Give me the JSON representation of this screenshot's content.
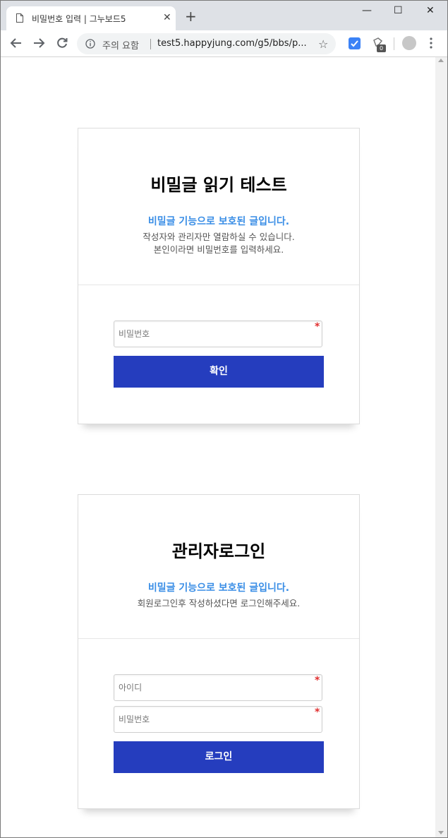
{
  "browser": {
    "tab_title": "비밀번호 입력 | 그누보드5",
    "tab_close": "✕",
    "new_tab": "+",
    "window_controls": {
      "minimize": "—",
      "maximize": "☐",
      "close": "✕"
    },
    "security_warning": "주의 요함",
    "url": "test5.happyjung.com/g5/bbs/p...",
    "star_glyph": "☆",
    "extension_badge": "0"
  },
  "secret_card": {
    "title": "비밀글 읽기 테스트",
    "subtitle": "비밀글 기능으로 보호된 글입니다.",
    "desc_line1": "작성자와 관리자만 열람하실 수 있습니다.",
    "desc_line2": "본인이라면 비밀번호를 입력하세요.",
    "password_placeholder": "비밀번호",
    "required_mark": "*",
    "confirm_label": "확인"
  },
  "login_card": {
    "title": "관리자로그인",
    "subtitle": "비밀글 기능으로 보호된 글입니다.",
    "desc": "회원로그인후 작성하셨다면 로그인해주세요.",
    "id_placeholder": "아이디",
    "password_placeholder": "비밀번호",
    "required_mark": "*",
    "login_label": "로그인"
  },
  "colors": {
    "accent_blue": "#3a8ee6",
    "button_bg": "#253dbe",
    "required_red": "#e03030"
  }
}
